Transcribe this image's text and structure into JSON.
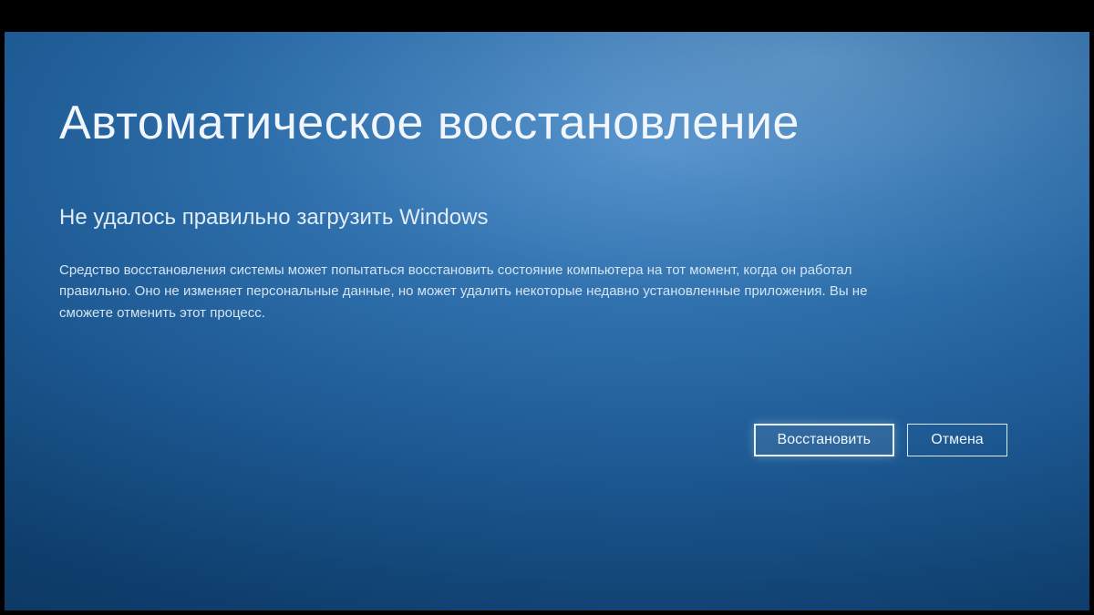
{
  "recovery": {
    "title": "Автоматическое восстановление",
    "subtitle": "Не удалось правильно загрузить Windows",
    "description": "Средство восстановления системы может попытаться восстановить состояние компьютера на тот момент, когда он работал правильно. Оно не изменяет персональные данные, но может удалить некоторые недавно установленные приложения. Вы не сможете отменить этот процесс.",
    "buttons": {
      "restore": "Восстановить",
      "cancel": "Отмена"
    }
  },
  "colors": {
    "background_primary": "#2e6fab",
    "background_dark": "#0a2d52",
    "text": "#e8f0f8",
    "border": "#dce8f4"
  }
}
